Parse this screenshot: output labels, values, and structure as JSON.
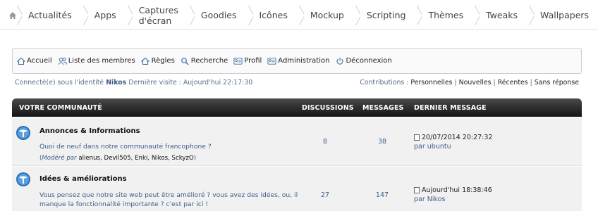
{
  "topnav": {
    "home_icon": "home-icon",
    "items": [
      {
        "label": "Actualités"
      },
      {
        "label": "Apps"
      },
      {
        "label": "Captures d'écran"
      },
      {
        "label": "Goodies"
      },
      {
        "label": "Icônes"
      },
      {
        "label": "Mockup"
      },
      {
        "label": "Scripting"
      },
      {
        "label": "Thèmes"
      },
      {
        "label": "Tweaks"
      },
      {
        "label": "Wallpapers"
      }
    ]
  },
  "menu": {
    "items": [
      {
        "label": "Accueil",
        "icon": "home-icon"
      },
      {
        "label": "Liste des membres",
        "icon": "members-icon"
      },
      {
        "label": "Règles",
        "icon": "rules-icon"
      },
      {
        "label": "Recherche",
        "icon": "search-icon"
      },
      {
        "label": "Profil",
        "icon": "profile-icon"
      },
      {
        "label": "Administration",
        "icon": "admin-icon"
      },
      {
        "label": "Déconnexion",
        "icon": "logout-icon"
      }
    ]
  },
  "info": {
    "connected_prefix": "Connecté(e) sous l'identité",
    "username": "Nikos",
    "last_visit": "Dernière visite : Aujourd'hui 22:17:30",
    "contributions_label": "Contributions :",
    "links": [
      "Personnelles",
      "Nouvelles",
      "Récentes",
      "Sans réponse"
    ],
    "separator": " | "
  },
  "table": {
    "headers": {
      "community": "VOTRE COMMUNAUTÉ",
      "discussions": "DISCUSSIONS",
      "messages": "MESSAGES",
      "last_message": "DERNIER MESSAGE"
    },
    "forums": [
      {
        "title": "Annonces & Informations",
        "desc_line1": "Quoi de neuf dans notre communauté francophone ?",
        "desc_line2": "",
        "mods_open": "(",
        "mods_label": "Modéré par",
        "mods_names": "alienus, Devil505, Enki, Nikos, SckyzO",
        "mods_close": ")",
        "discussions": "8",
        "messages": "38",
        "last_date": "20/07/2014 20:27:32",
        "last_by": "par ubuntu"
      },
      {
        "title": "Idées & améliorations",
        "desc_line1": "Vous pensez que notre site web peut être amélioré ? vous avez des idées, ou, il",
        "desc_line2": "manque la fonctionnalité importante ? c'est par ici !",
        "discussions": "27",
        "messages": "147",
        "last_date": "Aujourd'hui 18:38:46",
        "last_by": "par Nikos"
      }
    ]
  }
}
